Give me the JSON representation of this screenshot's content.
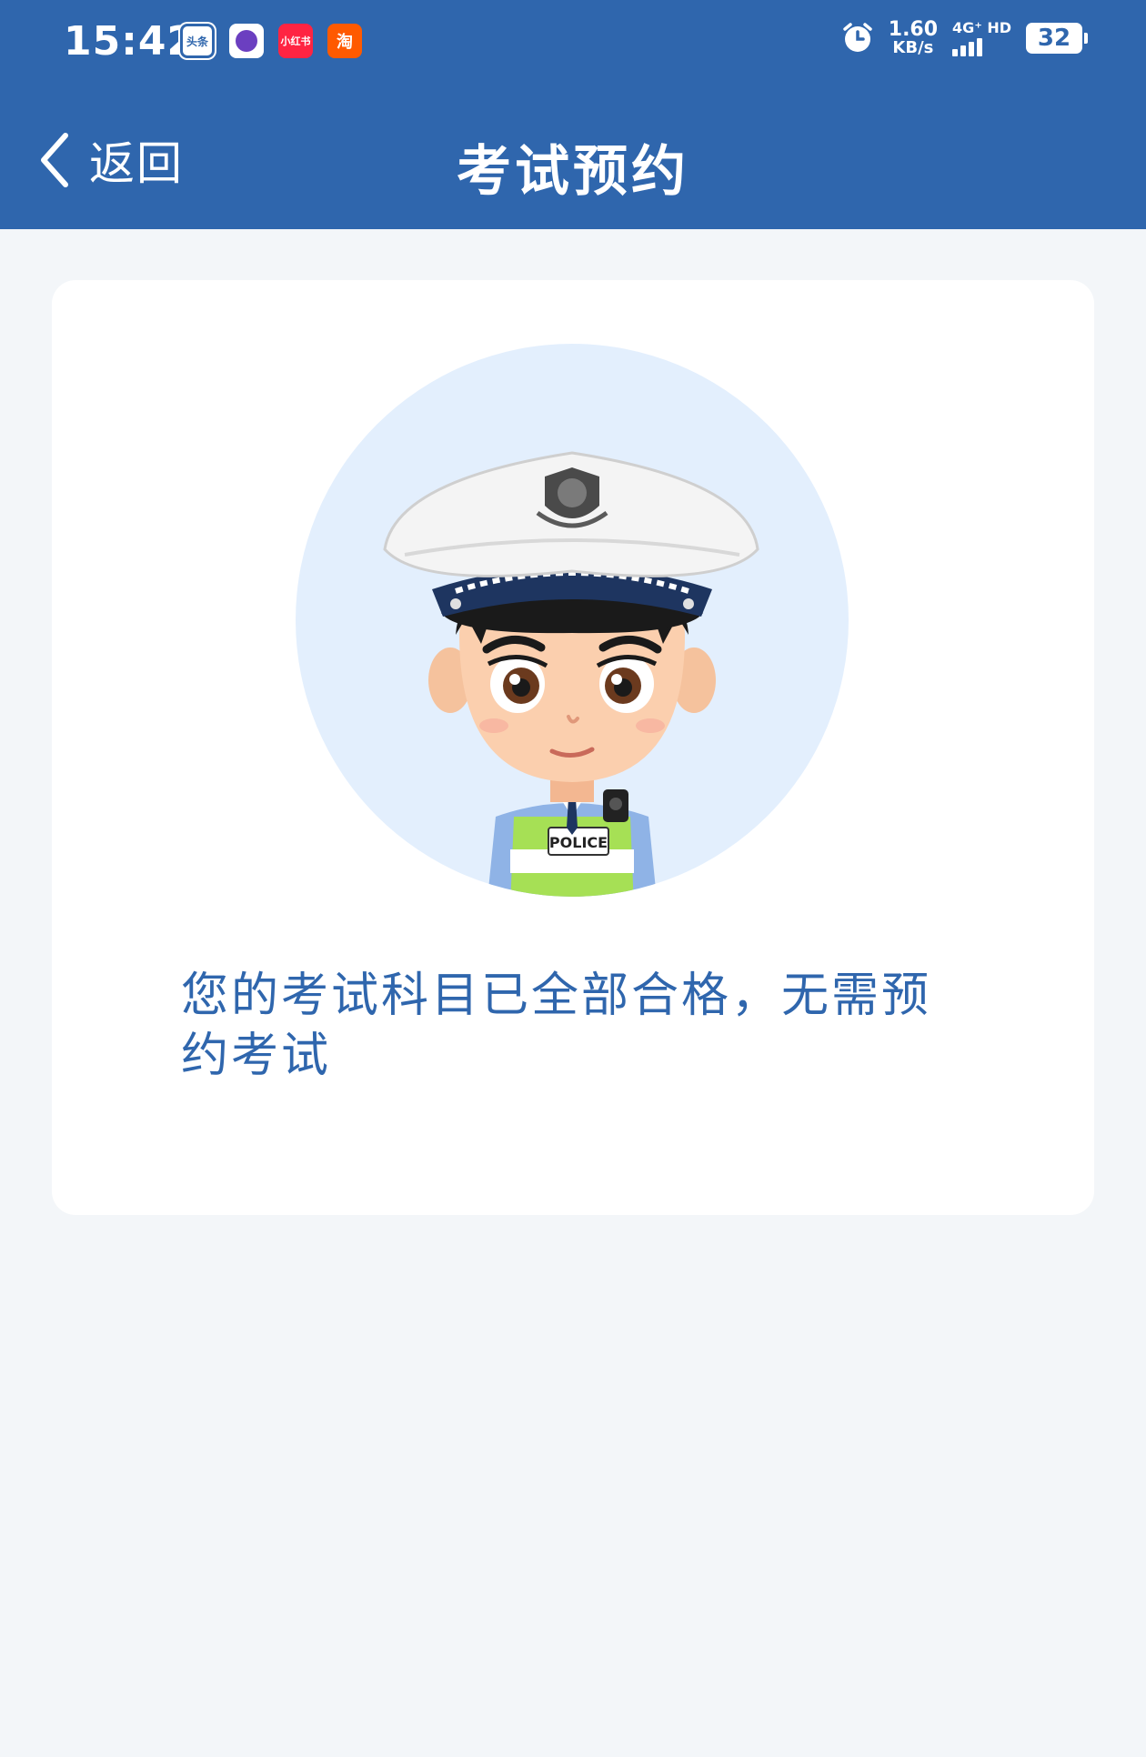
{
  "status_bar": {
    "time": "15:42",
    "app_icons": [
      {
        "name": "toutiao-app-icon",
        "label": "头条"
      },
      {
        "name": "purple-app-icon",
        "label": ""
      },
      {
        "name": "xiaohongshu-app-icon",
        "label": "小红书"
      },
      {
        "name": "taobao-app-icon",
        "label": "淘"
      }
    ],
    "net_speed": "1.60",
    "net_speed_unit": "KB/s",
    "network_label": "4G⁺ HD",
    "battery": "32"
  },
  "nav": {
    "back_label": "返回",
    "title": "考试预约"
  },
  "card": {
    "avatar_badge_text": "POLICE",
    "message": "您的考试科目已全部合格，无需预约考试"
  },
  "colors": {
    "brand_blue": "#2f66ad",
    "page_bg": "#f3f6f9",
    "avatar_circle": "#e3effd"
  }
}
